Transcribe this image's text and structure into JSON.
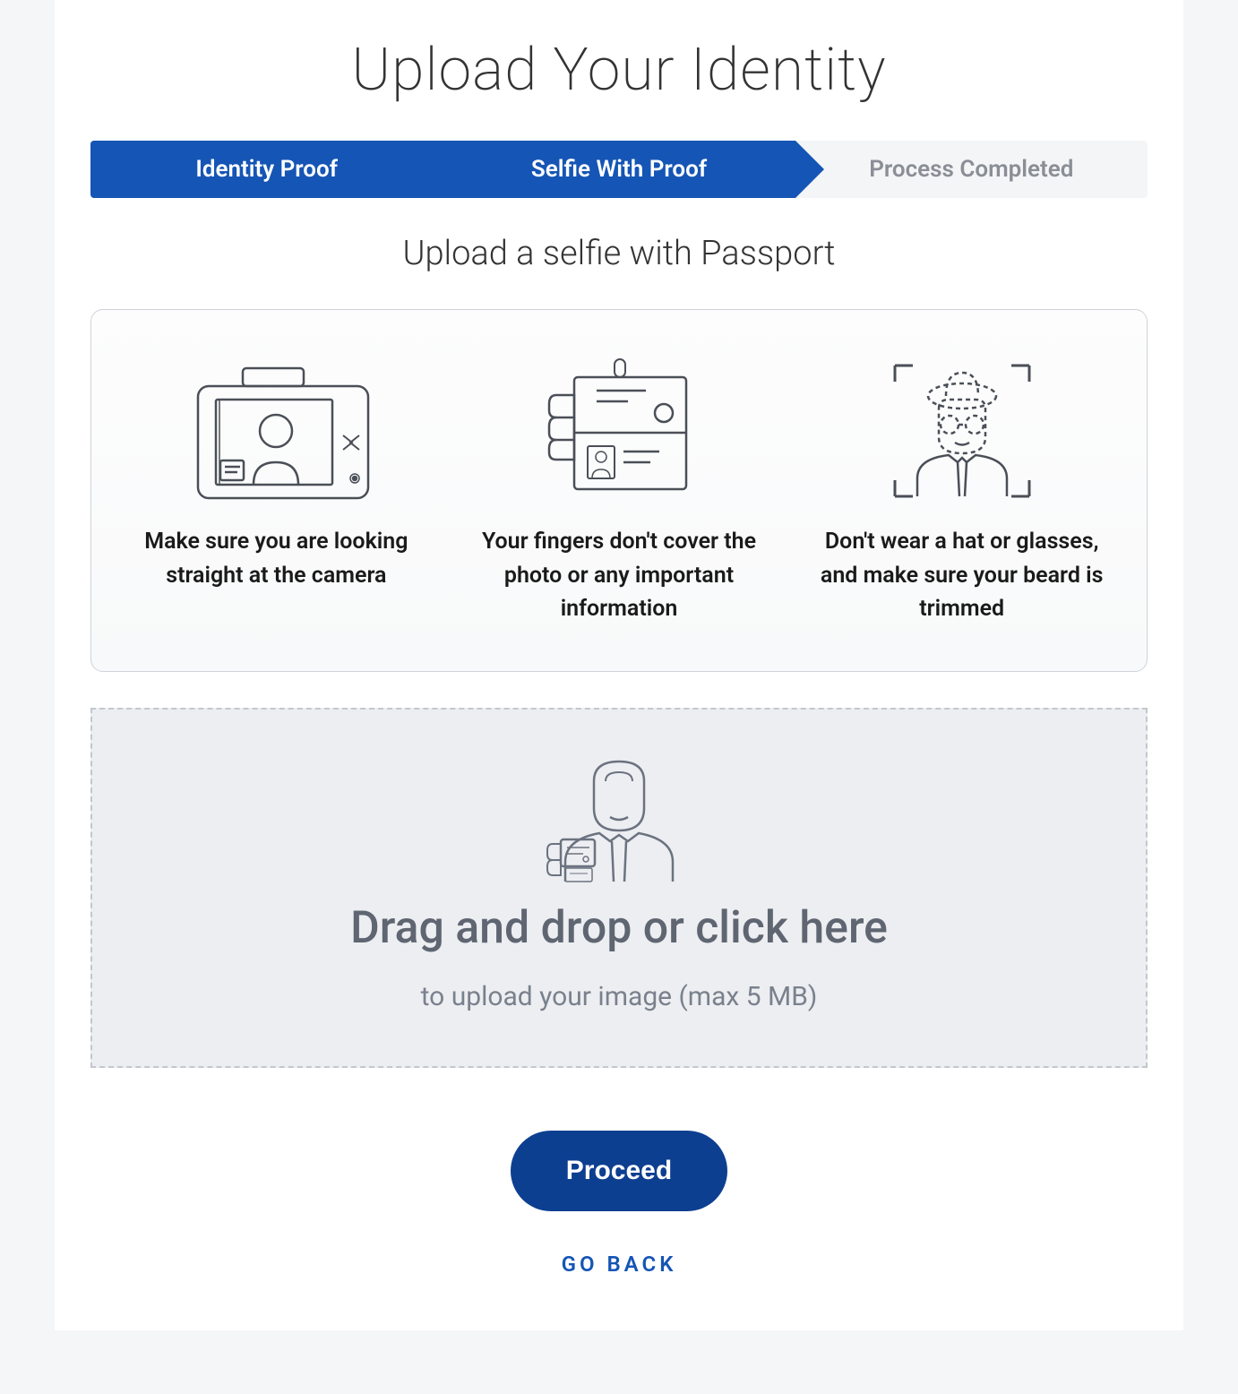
{
  "title": "Upload Your Identity",
  "steps": {
    "identity_proof": "Identity Proof",
    "selfie_with_proof": "Selfie With Proof",
    "process_completed": "Process Completed"
  },
  "subtitle": "Upload a selfie with Passport",
  "tips": {
    "camera": "Make sure you are looking straight at the camera",
    "fingers": "Your fingers don't cover the photo or any important information",
    "hat": "Don't wear a hat or glasses, and make sure your beard is trimmed"
  },
  "dropzone": {
    "title": "Drag and drop or click here",
    "subtitle": "to upload your image (max 5 MB)"
  },
  "buttons": {
    "proceed": "Proceed",
    "back": "Go Back"
  }
}
